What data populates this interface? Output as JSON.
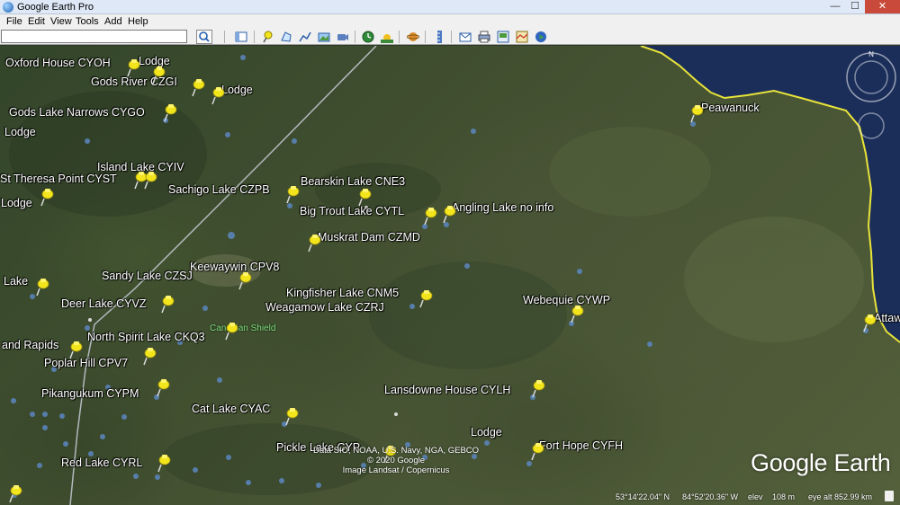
{
  "window": {
    "title": "Google Earth Pro",
    "minimize": "—",
    "maximize": "☐",
    "close": "✕"
  },
  "menu": [
    "File",
    "Edit",
    "View",
    "Tools",
    "Add",
    "Help"
  ],
  "search": {
    "value": "",
    "placeholder": ""
  },
  "toolbar_icons": [
    "sidebar-toggle-icon",
    "placemark-icon",
    "polygon-icon",
    "path-icon",
    "image-overlay-icon",
    "record-tour-icon",
    "historical-imagery-icon",
    "sunlight-icon",
    "planets-icon",
    "ruler-icon",
    "email-icon",
    "print-icon",
    "save-image-icon",
    "view-in-maps-icon",
    "earth-icon"
  ],
  "places": [
    {
      "label": "Oxford House CYOH"
    },
    {
      "label": "Lodge"
    },
    {
      "label": "Gods River CZGI"
    },
    {
      "label": "Lodge"
    },
    {
      "label": "Gods Lake Narrows CYGO"
    },
    {
      "label": "Lodge"
    },
    {
      "label": "Island Lake CYIV"
    },
    {
      "label": "St Theresa Point CYST"
    },
    {
      "label": "Lodge"
    },
    {
      "label": "Sachigo Lake CZPB"
    },
    {
      "label": "Bearskin Lake CNE3"
    },
    {
      "label": "Big Trout Lake CYTL"
    },
    {
      "label": "Angling Lake no info"
    },
    {
      "label": "Muskrat Dam CZMD"
    },
    {
      "label": "Keewaywin CPV8"
    },
    {
      "label": "Sandy Lake CZSJ"
    },
    {
      "label": "Lake"
    },
    {
      "label": "Kingfisher Lake CNM5"
    },
    {
      "label": "Weagamow Lake CZRJ"
    },
    {
      "label": "Deer Lake CYVZ"
    },
    {
      "label": "North Spirit Lake CKQ3"
    },
    {
      "label": "and Rapids"
    },
    {
      "label": "Poplar Hill CPV7"
    },
    {
      "label": "Pikangukum CYPM"
    },
    {
      "label": "Cat Lake CYAC"
    },
    {
      "label": "Lansdowne House CYLH"
    },
    {
      "label": "Webequie CYWP"
    },
    {
      "label": "Peawanuck"
    },
    {
      "label": "Attaw"
    },
    {
      "label": "Lodge"
    },
    {
      "label": "Fort Hope CYFH"
    },
    {
      "label": "Pickle Lake CYP"
    },
    {
      "label": "Red Lake CYRL"
    }
  ],
  "region_label": "Canadian Shield",
  "attribution": [
    "Data SIO, NOAA, U.S. Navy, NGA, GEBCO",
    "© 2020 Google",
    "Image Landsat / Copernicus"
  ],
  "logo": "Google Earth",
  "status": {
    "lat": "53°14'22.04\" N",
    "lon": "84°52'20.36\" W",
    "elev_label": "elev",
    "elev": "108 m",
    "eye_alt": "eye alt 852.99 km"
  },
  "colors": {
    "pin": "#f3e51c",
    "coastline": "#e8e33a",
    "water": "#1b2e5a",
    "boundary_line": "#c8cdd8",
    "label": "#ffffff",
    "region_label": "#7ee07e"
  }
}
